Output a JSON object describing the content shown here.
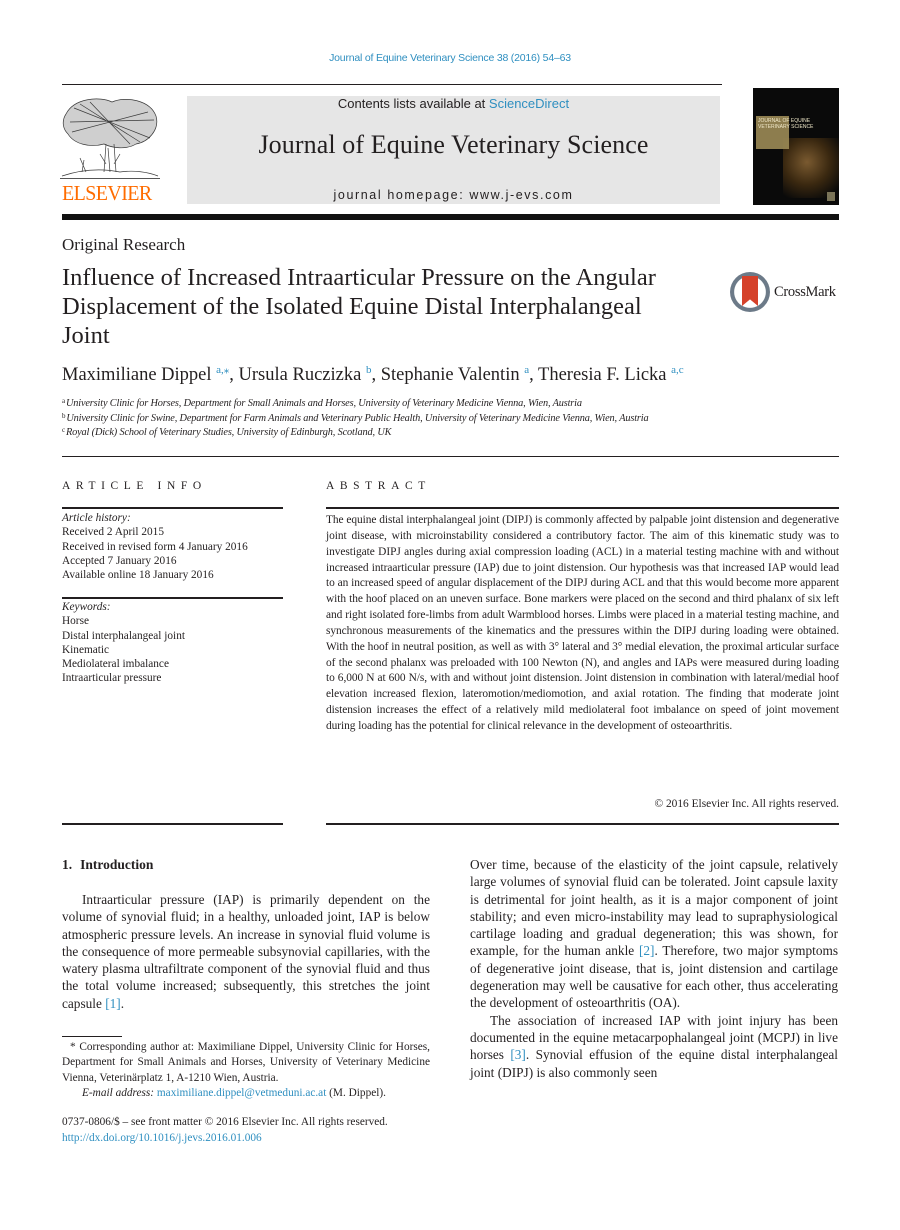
{
  "header": {
    "citation": "Journal of Equine Veterinary Science 38 (2016) 54–63",
    "publisher_logo_text": "ELSEVIER",
    "contents_prefix": "Contents lists available at ",
    "contents_link": "ScienceDirect",
    "journal_title": "Journal of Equine Veterinary Science",
    "homepage": "journal homepage: www.j-evs.com",
    "cover_title": "JOURNAL OF EQUINE VETERINARY SCIENCE"
  },
  "article": {
    "section": "Original Research",
    "title": "Influence of Increased Intraarticular Pressure on the Angular Displacement of the Isolated Equine Distal Interphalangeal Joint",
    "crossmark_label": "CrossMark",
    "authors": [
      {
        "name": "Maximiliane Dippel",
        "sup": "a,⁎"
      },
      {
        "name": "Ursula Ruczizka",
        "sup": "b"
      },
      {
        "name": "Stephanie Valentin",
        "sup": "a"
      },
      {
        "name": "Theresia F. Licka",
        "sup": "a,c"
      }
    ],
    "affiliations": [
      {
        "mark": "a",
        "text": "University Clinic for Horses, Department for Small Animals and Horses, University of Veterinary Medicine Vienna, Wien, Austria"
      },
      {
        "mark": "b",
        "text": "University Clinic for Swine, Department for Farm Animals and Veterinary Public Health, University of Veterinary Medicine Vienna, Wien, Austria"
      },
      {
        "mark": "c",
        "text": "Royal (Dick) School of Veterinary Studies, University of Edinburgh, Scotland, UK"
      }
    ]
  },
  "article_info": {
    "heading": "ARTICLE INFO",
    "history_label": "Article history:",
    "history": [
      "Received 2 April 2015",
      "Received in revised form 4 January 2016",
      "Accepted 7 January 2016",
      "Available online 18 January 2016"
    ],
    "keywords_label": "Keywords:",
    "keywords": [
      "Horse",
      "Distal interphalangeal joint",
      "Kinematic",
      "Mediolateral imbalance",
      "Intraarticular pressure"
    ]
  },
  "abstract": {
    "heading": "ABSTRACT",
    "text": "The equine distal interphalangeal joint (DIPJ) is commonly affected by palpable joint distension and degenerative joint disease, with microinstability considered a contributory factor. The aim of this kinematic study was to investigate DIPJ angles during axial compression loading (ACL) in a material testing machine with and without increased intraarticular pressure (IAP) due to joint distension. Our hypothesis was that increased IAP would lead to an increased speed of angular displacement of the DIPJ during ACL and that this would become more apparent with the hoof placed on an uneven surface. Bone markers were placed on the second and third phalanx of six left and right isolated fore-limbs from adult Warmblood horses. Limbs were placed in a material testing machine, and synchronous measurements of the kinematics and the pressures within the DIPJ during loading were obtained. With the hoof in neutral position, as well as with 3° lateral and 3° medial elevation, the proximal articular surface of the second phalanx was preloaded with 100 Newton (N), and angles and IAPs were measured during loading to 6,000 N at 600 N/s, with and without joint distension. Joint distension in combination with lateral/medial hoof elevation increased flexion, lateromotion/mediomotion, and axial rotation. The finding that moderate joint distension increases the effect of a relatively mild mediolateral foot imbalance on speed of joint movement during loading has the potential for clinical relevance in the development of osteoarthritis.",
    "copyright": "© 2016 Elsevier Inc. All rights reserved."
  },
  "introduction": {
    "number": "1.",
    "heading": "Introduction",
    "left_para": {
      "before_ref": "Intraarticular pressure (IAP) is primarily dependent on the volume of synovial fluid; in a healthy, unloaded joint, IAP is below atmospheric pressure levels. An increase in synovial fluid volume is the consequence of more permeable subsynovial capillaries, with the watery plasma ultrafiltrate component of the synovial fluid and thus the total volume increased; subsequently, this stretches the joint capsule ",
      "ref": "[1]",
      "after_ref": "."
    },
    "right_para1": {
      "before_ref": "Over time, because of the elasticity of the joint capsule, relatively large volumes of synovial fluid can be tolerated. Joint capsule laxity is detrimental for joint health, as it is a major component of joint stability; and even micro-instability may lead to supraphysiological cartilage loading and gradual degeneration; this was shown, for example, for the human ankle ",
      "ref": "[2]",
      "after_ref": ". Therefore, two major symptoms of degenerative joint disease, that is, joint distension and cartilage degeneration may well be causative for each other, thus accelerating the development of osteoarthritis (OA)."
    },
    "right_para2": {
      "before_ref": "The association of increased IAP with joint injury has been documented in the equine metacarpophalangeal joint (MCPJ) in live horses ",
      "ref": "[3]",
      "after_ref": ". Synovial effusion of the equine distal interphalangeal joint (DIPJ) is also commonly seen"
    }
  },
  "footnote": {
    "corresponding": "* Corresponding author at: Maximiliane Dippel, University Clinic for Horses, Department for Small Animals and Horses, University of Veterinary Medicine Vienna, Veterinärplatz 1, A-1210 Wien, Austria.",
    "email_label": "E-mail address:",
    "email": "maximiliane.dippel@vetmeduni.ac.at",
    "email_suffix": " (M. Dippel)."
  },
  "front_matter": {
    "issn_line": "0737-0806/$ – see front matter © 2016 Elsevier Inc. All rights reserved.",
    "doi": "http://dx.doi.org/10.1016/j.jevs.2016.01.006"
  }
}
